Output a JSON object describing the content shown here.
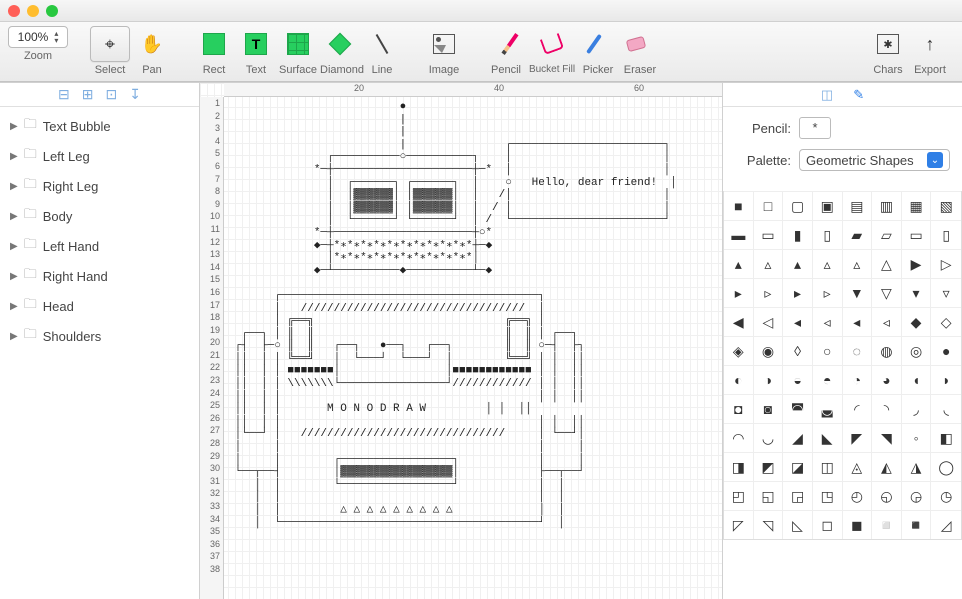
{
  "zoom": {
    "value": "100%",
    "label": "Zoom"
  },
  "toolbar": {
    "select": "Select",
    "pan": "Pan",
    "rect": "Rect",
    "text": "Text",
    "surface": "Surface",
    "diamond": "Diamond",
    "line": "Line",
    "image": "Image",
    "pencil": "Pencil",
    "bucket": "Bucket Fill",
    "picker": "Picker",
    "eraser": "Eraser",
    "chars": "Chars",
    "export": "Export"
  },
  "layers": {
    "items": [
      {
        "label": "Text Bubble"
      },
      {
        "label": "Left Leg"
      },
      {
        "label": "Right Leg"
      },
      {
        "label": "Body"
      },
      {
        "label": "Left Hand"
      },
      {
        "label": "Right Hand"
      },
      {
        "label": "Head"
      },
      {
        "label": "Shoulders"
      }
    ]
  },
  "ruler": {
    "marks": [
      "20",
      "40",
      "60"
    ]
  },
  "inspector": {
    "pencil_label": "Pencil:",
    "pencil_char": "*",
    "palette_label": "Palette:",
    "palette_value": "Geometric Shapes",
    "glyphs": [
      "■",
      "□",
      "▢",
      "▣",
      "▤",
      "▥",
      "▦",
      "▧",
      "▬",
      "▭",
      "▮",
      "▯",
      "▰",
      "▱",
      "▭",
      "▯",
      "▴",
      "▵",
      "▴",
      "▵",
      "▵",
      "△",
      "▶",
      "▷",
      "▸",
      "▹",
      "▸",
      "▹",
      "▼",
      "▽",
      "▾",
      "▿",
      "◀",
      "◁",
      "◂",
      "◃",
      "◂",
      "◃",
      "◆",
      "◇",
      "◈",
      "◉",
      "◊",
      "○",
      "◌",
      "◍",
      "◎",
      "●",
      "◐",
      "◑",
      "◒",
      "◓",
      "◔",
      "◕",
      "◖",
      "◗",
      "◘",
      "◙",
      "◚",
      "◛",
      "◜",
      "◝",
      "◞",
      "◟",
      "◠",
      "◡",
      "◢",
      "◣",
      "◤",
      "◥",
      "◦",
      "◧",
      "◨",
      "◩",
      "◪",
      "◫",
      "◬",
      "◭",
      "◮",
      "◯",
      "◰",
      "◱",
      "◲",
      "◳",
      "◴",
      "◵",
      "◶",
      "◷",
      "◸",
      "◹",
      "◺",
      "◻",
      "◼",
      "◽",
      "◾",
      "◿"
    ]
  },
  "canvas": {
    "speech": "Hello, dear friend!",
    "body_text": "M O N O D R A W",
    "line_numbers": 38
  }
}
